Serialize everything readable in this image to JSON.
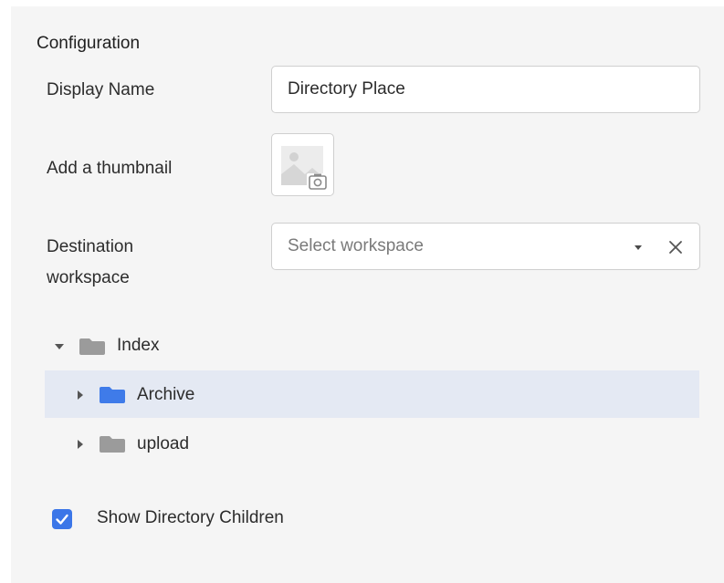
{
  "section": {
    "title": "Configuration"
  },
  "display_name": {
    "label": "Display Name",
    "value": "Directory Place"
  },
  "thumbnail": {
    "label": "Add a thumbnail",
    "icon": "image-upload-icon"
  },
  "destination": {
    "label_line1": "Destination",
    "label_line2": "workspace",
    "placeholder": "Select workspace",
    "dropdown_icon": "caret-down-icon",
    "clear_icon": "close-icon"
  },
  "tree": {
    "root": {
      "label": "Index",
      "expanded": true,
      "folder_color": "#9b9b9b"
    },
    "children": [
      {
        "label": "Archive",
        "expanded": false,
        "selected": true,
        "folder_color": "#3f7be9"
      },
      {
        "label": "upload",
        "expanded": false,
        "selected": false,
        "folder_color": "#9b9b9b"
      }
    ],
    "selected_row_color": "#e4e9f3"
  },
  "options": {
    "show_children": {
      "label": "Show Directory Children",
      "checked": true,
      "color": "#3b76e8"
    }
  }
}
